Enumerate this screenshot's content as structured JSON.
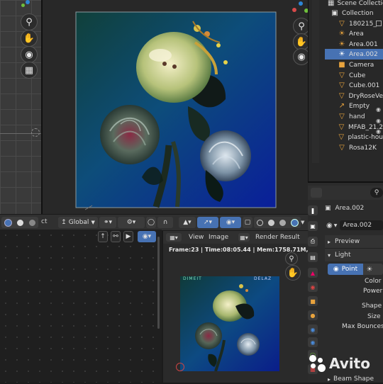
{
  "viewport": {
    "pivot_label": "Global"
  },
  "render_window": {
    "view_menu": "View",
    "image_menu": "Image",
    "title": "Render Result",
    "status": "Frame:23 | Time:08:05.44 | Mem:1758.71M, Peak:",
    "corner_left_text": "DIMEIT",
    "corner_right_text": "DELAZ"
  },
  "outliner": {
    "root_label": "Scene Collection",
    "items": [
      {
        "label": "Collection",
        "icon": "collection-icon",
        "color": "#e0e0e0"
      },
      {
        "label": "180215_",
        "icon": "object-icon",
        "color": "#e8a33d"
      },
      {
        "label": "Area",
        "icon": "light-icon",
        "color": "#e8a33d"
      },
      {
        "label": "Area.001",
        "icon": "light-icon",
        "color": "#e8a33d"
      },
      {
        "label": "Area.002",
        "icon": "light-icon",
        "color": "#ffffff"
      },
      {
        "label": "Camera",
        "icon": "camera-icon",
        "color": "#e8a33d"
      },
      {
        "label": "Cube",
        "icon": "mesh-icon",
        "color": "#e8a33d"
      },
      {
        "label": "Cube.001",
        "icon": "mesh-icon",
        "color": "#e8a33d"
      },
      {
        "label": "DryRoseVe",
        "icon": "mesh-icon",
        "color": "#e8a33d"
      },
      {
        "label": "Empty",
        "icon": "empty-icon",
        "color": "#e8a33d"
      },
      {
        "label": "hand",
        "icon": "mesh-icon",
        "color": "#e8a33d"
      },
      {
        "label": "MFAB_21.2",
        "icon": "mesh-icon",
        "color": "#e8a33d"
      },
      {
        "label": "plastic-hou",
        "icon": "mesh-icon",
        "color": "#e8a33d"
      },
      {
        "label": "Rosa12K",
        "icon": "mesh-icon",
        "color": "#e8a33d"
      }
    ]
  },
  "properties": {
    "header_object": "Area.002",
    "data_name": "Area.002",
    "preview_label": "Preview",
    "light_section": "Light",
    "light_type_selected": "Point",
    "fields": [
      "Color",
      "Power",
      "Shape",
      "Size",
      "Max Bounces"
    ],
    "beam_shape": "Beam Shape"
  },
  "watermark": "Avito",
  "colors": {
    "accent_blue": "#4772b3",
    "selection_orange": "#e8a33d",
    "render_bg_top": "#0f3b3a",
    "render_bg_bottom": "#0a1d8a"
  }
}
